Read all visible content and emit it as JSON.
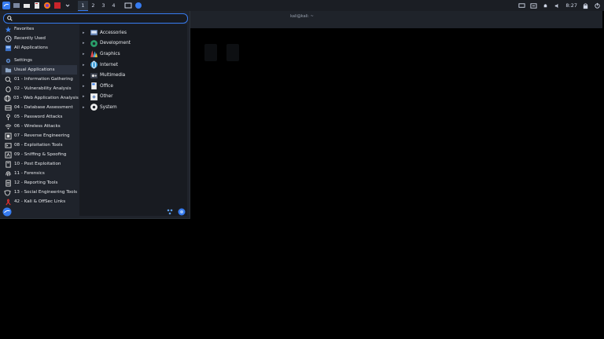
{
  "panel": {
    "workspaces": [
      "1",
      "2",
      "3",
      "4"
    ],
    "clock": "8:27"
  },
  "terminal": {
    "title": "kali@kali: ~"
  },
  "menu": {
    "search_placeholder": "",
    "categories": [
      {
        "label": "Favorites",
        "icon": "star-icon"
      },
      {
        "label": "Recently Used",
        "icon": "clock-icon"
      },
      {
        "label": "All Applications",
        "icon": "grid-icon"
      },
      {
        "label": "Settings",
        "icon": "gear-icon"
      },
      {
        "label": "Usual Applications",
        "icon": "folder-icon"
      },
      {
        "label": "01 - Information Gathering",
        "icon": "magnifier-icon"
      },
      {
        "label": "02 - Vulnerability Analysis",
        "icon": "bug-icon"
      },
      {
        "label": "03 - Web Application Analysis",
        "icon": "globe-icon"
      },
      {
        "label": "04 - Database Assessment",
        "icon": "database-icon"
      },
      {
        "label": "05 - Password Attacks",
        "icon": "key-icon"
      },
      {
        "label": "06 - Wireless Attacks",
        "icon": "wifi-icon"
      },
      {
        "label": "07 - Reverse Engineering",
        "icon": "chip-icon"
      },
      {
        "label": "08 - Exploitation Tools",
        "icon": "terminal-icon"
      },
      {
        "label": "09 - Sniffing & Spoofing",
        "icon": "antenna-icon"
      },
      {
        "label": "10 - Post Exploitation",
        "icon": "flag-icon"
      },
      {
        "label": "11 - Forensics",
        "icon": "fingerprint-icon"
      },
      {
        "label": "12 - Reporting Tools",
        "icon": "document-icon"
      },
      {
        "label": "13 - Social Engineering Tools",
        "icon": "mask-icon"
      },
      {
        "label": "42 - Kali & OffSec Links",
        "icon": "ribbon-icon"
      }
    ],
    "submenu": [
      {
        "label": "Accessories",
        "icon": "accessories-icon"
      },
      {
        "label": "Development",
        "icon": "development-icon"
      },
      {
        "label": "Graphics",
        "icon": "graphics-icon"
      },
      {
        "label": "Internet",
        "icon": "internet-icon"
      },
      {
        "label": "Multimedia",
        "icon": "multimedia-icon"
      },
      {
        "label": "Office",
        "icon": "office-icon"
      },
      {
        "label": "Other",
        "icon": "other-icon"
      },
      {
        "label": "System",
        "icon": "system-icon"
      }
    ]
  },
  "colors": {
    "accent": "#367bf0",
    "panel_bg": "#1b1e24",
    "menu_bg": "#1f232b"
  }
}
